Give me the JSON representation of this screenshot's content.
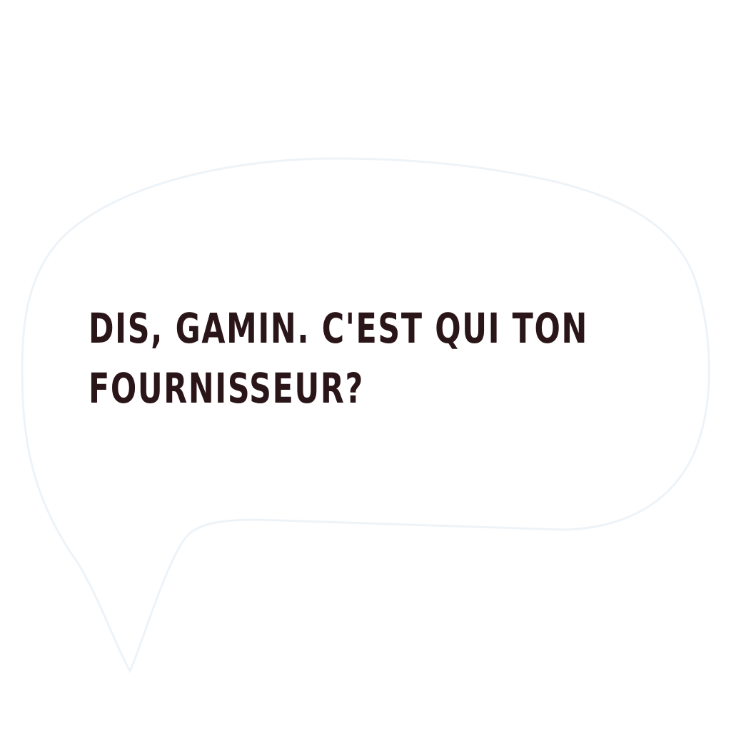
{
  "speech_bubble": {
    "line_1": "DIS, GAMIN. C'EST QUI TON",
    "line_2": "FOURNISSEUR?"
  },
  "colors": {
    "background": "#ffffff",
    "bubble_fill": "#ffffff",
    "bubble_outline": "#eef3f8",
    "text": "#2a1518"
  }
}
